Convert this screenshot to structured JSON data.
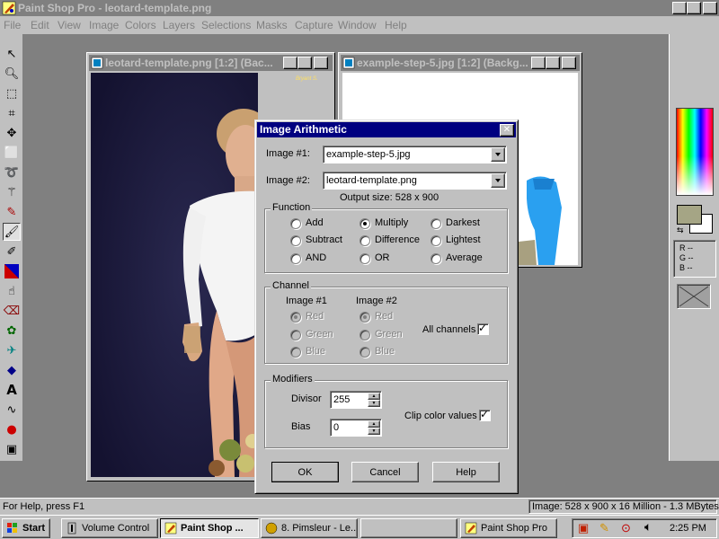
{
  "app": {
    "title": "Paint Shop Pro - leotard-template.png",
    "menu": [
      "File",
      "Edit",
      "View",
      "Image",
      "Colors",
      "Layers",
      "Selections",
      "Masks",
      "Capture",
      "Window",
      "Help"
    ]
  },
  "toolbox": {
    "tools": [
      "arrow-icon",
      "zoom-icon",
      "deform-icon",
      "crop-icon",
      "mover-icon",
      "selection-icon",
      "lasso-icon",
      "magic-wand-icon",
      "dropper-icon",
      "paintbrush-icon",
      "clone-brush-icon",
      "color-replacer-icon",
      "retouch-icon",
      "eraser-icon",
      "picture-tube-icon",
      "airbrush-icon",
      "flood-fill-icon",
      "text-icon",
      "draw-icon",
      "preset-shapes-icon",
      "object-selector-icon"
    ]
  },
  "windows": {
    "left": {
      "title": "leotard-template.png [1:2] (Bac...",
      "watermark": "Bryant S."
    },
    "right": {
      "title": "example-step-5.jpg [1:2] (Backg..."
    }
  },
  "dialog": {
    "title": "Image Arithmetic",
    "image1_label": "Image #1:",
    "image1_value": "example-step-5.jpg",
    "image2_label": "Image #2:",
    "image2_value": "leotard-template.png",
    "output_size": "Output size: 528 x 900",
    "function": {
      "label": "Function",
      "options": [
        "Add",
        "Subtract",
        "AND",
        "Multiply",
        "Difference",
        "OR",
        "Darkest",
        "Lightest",
        "Average"
      ],
      "selected": "Multiply"
    },
    "channel": {
      "label": "Channel",
      "image1_header": "Image #1",
      "image2_header": "Image #2",
      "options": [
        "Red",
        "Green",
        "Blue"
      ],
      "all_channels_label": "All channels",
      "all_channels_checked": true
    },
    "modifiers": {
      "label": "Modifiers",
      "divisor_label": "Divisor",
      "divisor_value": "255",
      "bias_label": "Bias",
      "bias_value": "0",
      "clip_label": "Clip color values",
      "clip_checked": true
    },
    "buttons": {
      "ok": "OK",
      "cancel": "Cancel",
      "help": "Help"
    }
  },
  "colors": {
    "foreground": "#a5a585",
    "background": "#ffffff",
    "rgb_labels": [
      "R --",
      "G --",
      "B --"
    ]
  },
  "status": {
    "help_text": "For Help, press F1",
    "image_info": "Image:  528 x 900 x 16 Million - 1.3 MBytes"
  },
  "taskbar": {
    "start": "Start",
    "tasks": [
      "Volume Control",
      "Paint Shop ...",
      "8. Pimsleur - Le...",
      "",
      "Paint Shop Pro"
    ],
    "active_task": "Paint Shop ...",
    "clock": "2:25 PM"
  }
}
